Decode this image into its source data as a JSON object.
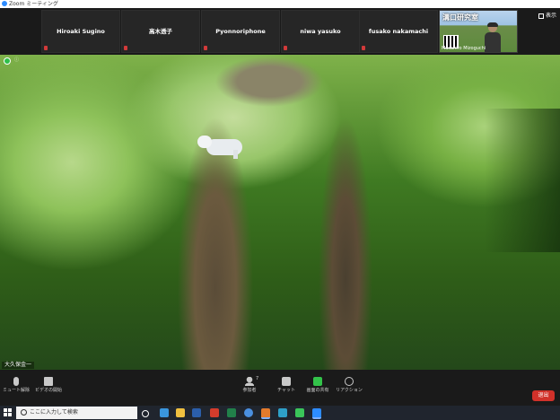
{
  "window": {
    "title": "Zoom ミーティング"
  },
  "participants": [
    {
      "name": "Hiroaki Sugino"
    },
    {
      "name": "高木透子"
    },
    {
      "name": "Pyonnoriphone"
    },
    {
      "name": "niwa yasuko"
    },
    {
      "name": "fusako nakamachi"
    }
  ],
  "self_view": {
    "sign_text": "溝口研究室",
    "name": "Masahiro Mizoguchi"
  },
  "view_button": {
    "label": "表示"
  },
  "main_video": {
    "speaker_name": "大久保金一"
  },
  "toolbar": {
    "mute_label": "ミュート解除",
    "video_label": "ビデオの開始",
    "participants_label": "参加者",
    "participants_count": "7",
    "chat_label": "チャット",
    "share_label": "画面の共有",
    "reactions_label": "リアクション",
    "leave_label": "退出"
  },
  "taskbar": {
    "search_placeholder": "ここに入力して検索",
    "apps": [
      "task-view-icon",
      "edge-icon",
      "file-explorer-icon",
      "word-icon",
      "acrobat-icon",
      "excel-icon",
      "chrome-icon",
      "firefox-icon",
      "media-icon",
      "line-icon",
      "zoom-icon"
    ]
  },
  "colors": {
    "leave": "#d1312a",
    "share": "#33c34a",
    "background": "#1a1a1a"
  }
}
